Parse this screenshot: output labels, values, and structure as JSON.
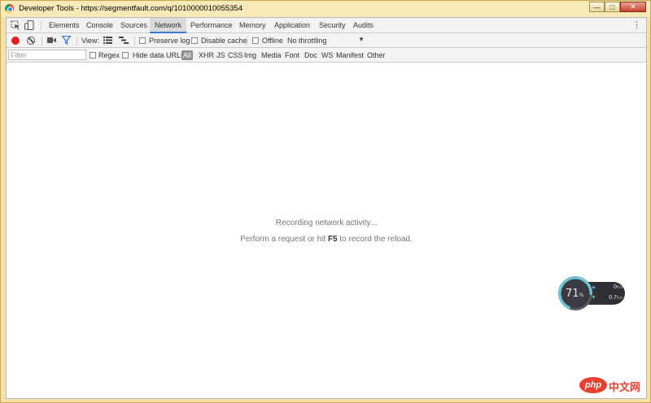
{
  "window": {
    "title": "Developer Tools - https://segmentfault.com/q/1010000010055354",
    "minimize_label": "—",
    "maximize_label": "□",
    "close_label": "✕"
  },
  "tabs": [
    {
      "label": "Elements"
    },
    {
      "label": "Console"
    },
    {
      "label": "Sources"
    },
    {
      "label": "Network",
      "active": true
    },
    {
      "label": "Performance"
    },
    {
      "label": "Memory"
    },
    {
      "label": "Application"
    },
    {
      "label": "Security"
    },
    {
      "label": "Audits"
    }
  ],
  "toolbar": {
    "view_label": "View:",
    "preserve_log": "Preserve log",
    "disable_cache": "Disable cache",
    "offline": "Offline",
    "throttling": "No throttling",
    "kebab": "⋮"
  },
  "filter": {
    "placeholder": "Filter",
    "regex": "Regex",
    "hide_data_urls": "Hide data URLs",
    "types": [
      "All",
      "XHR",
      "JS",
      "CSS",
      "Img",
      "Media",
      "Font",
      "Doc",
      "WS",
      "Manifest",
      "Other"
    ]
  },
  "panel": {
    "recording": "Recording network activity...",
    "hint_before": "Perform a request or hit ",
    "hint_key": "F5",
    "hint_after": " to record the reload."
  },
  "widget": {
    "percent": "71",
    "percent_unit": "%",
    "upload": "0",
    "download": "0.7",
    "rate_unit": "K/s",
    "load_fraction": 0.71
  },
  "watermark": {
    "logo": "php",
    "text": "中文网"
  },
  "icons": {
    "inspect": "inspect-element-icon",
    "device": "device-toolbar-icon",
    "record": "record-icon",
    "clear": "clear-icon",
    "camera": "capture-screenshots-icon",
    "filter": "filter-icon",
    "large_rows": "large-request-rows-icon",
    "overview": "show-overview-icon"
  },
  "colors": {
    "active_tab_underline": "#3879d9",
    "record_red": "#e21e1e",
    "filter_blue": "#3879d9"
  }
}
